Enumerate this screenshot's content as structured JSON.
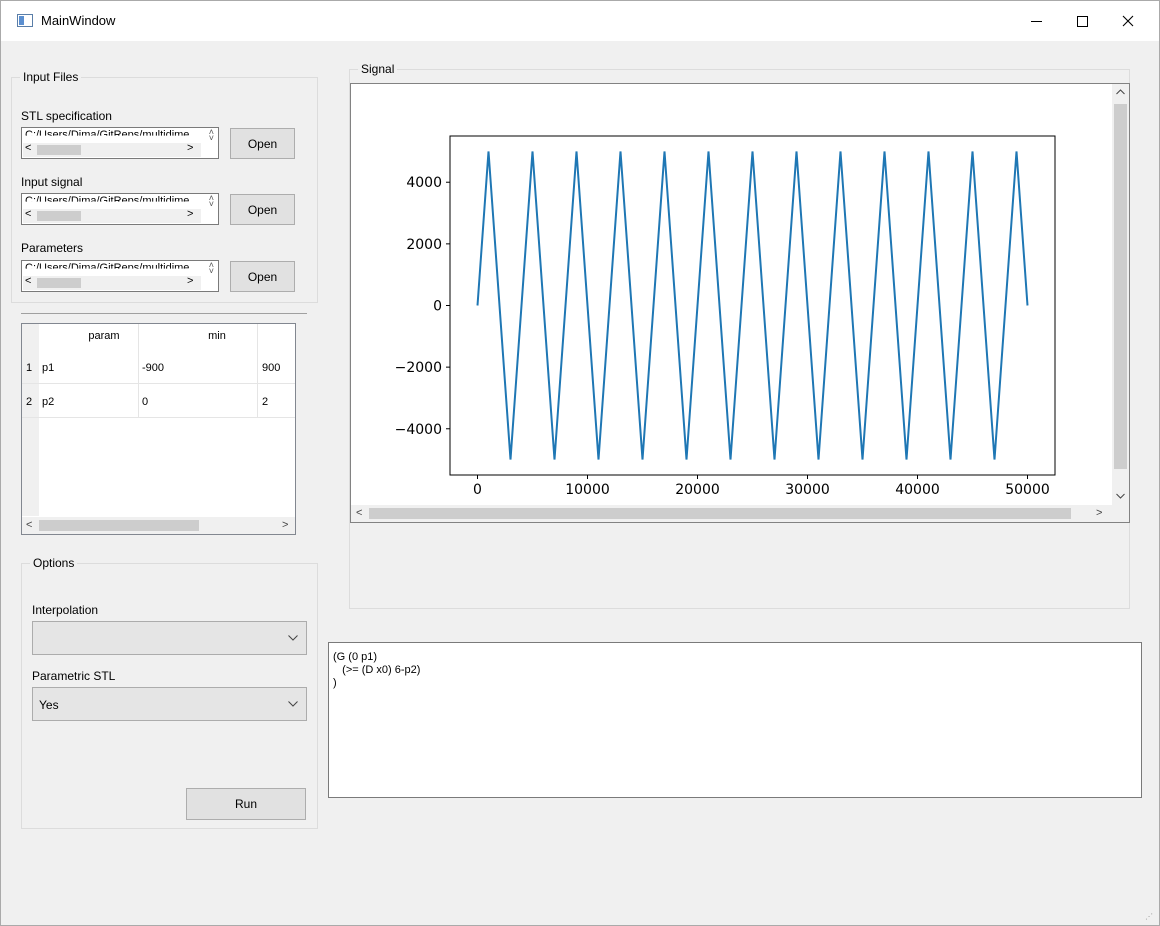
{
  "window": {
    "title": "MainWindow",
    "minimize": "—",
    "maximize": "☐",
    "close": "✕"
  },
  "input_files": {
    "group_title": "Input Files",
    "stl": {
      "label": "STL specification",
      "path": "C:/Users/Dima/GitReps/multidime",
      "button": "Open"
    },
    "signal": {
      "label": "Input signal",
      "path": "C:/Users/Dima/GitReps/multidime",
      "button": "Open"
    },
    "params": {
      "label": "Parameters",
      "path": "C:/Users/Dima/GitReps/multidime",
      "button": "Open"
    }
  },
  "param_table": {
    "headers": [
      "param",
      "min"
    ],
    "rows": [
      {
        "index": "1",
        "param": "p1",
        "min": "-900",
        "max": "900"
      },
      {
        "index": "2",
        "param": "p2",
        "min": "0",
        "max": "2"
      }
    ]
  },
  "options": {
    "group_title": "Options",
    "interpolation_label": "Interpolation",
    "interpolation_value": "",
    "parametric_label": "Parametric STL",
    "parametric_value": "Yes",
    "run_button": "Run"
  },
  "signal_panel": {
    "group_title": "Signal"
  },
  "chart_data": {
    "type": "line",
    "title": "",
    "xlabel": "",
    "ylabel": "",
    "xlim": [
      -2500,
      52500
    ],
    "ylim": [
      -5500,
      5500
    ],
    "x_ticks": [
      0,
      10000,
      20000,
      30000,
      40000,
      50000
    ],
    "x_tick_labels": [
      "0",
      "10000",
      "20000",
      "30000",
      "40000",
      "50000"
    ],
    "y_ticks": [
      4000,
      2000,
      0,
      -2000,
      -4000
    ],
    "y_tick_labels": [
      "4000",
      "2000",
      "0",
      "−2000",
      "−4000"
    ],
    "color": "#1f77b4",
    "series": [
      {
        "x": [
          0,
          1000,
          3000,
          5000,
          7000,
          9000,
          11000,
          13000,
          15000,
          17000,
          19000,
          21000,
          23000,
          25000,
          27000,
          29000,
          31000,
          33000,
          35000,
          37000,
          39000,
          41000,
          43000,
          45000,
          47000,
          49000,
          50000
        ],
        "y": [
          0,
          5000,
          -5000,
          5000,
          -5000,
          5000,
          -5000,
          5000,
          -5000,
          5000,
          -5000,
          5000,
          -5000,
          5000,
          -5000,
          5000,
          -5000,
          5000,
          -5000,
          5000,
          -5000,
          5000,
          -5000,
          5000,
          -5000,
          5000,
          0
        ]
      }
    ]
  },
  "editor": {
    "lines": [
      "(G (0 p1)",
      "   (>= (D x0) 6-p2)",
      ")"
    ]
  }
}
